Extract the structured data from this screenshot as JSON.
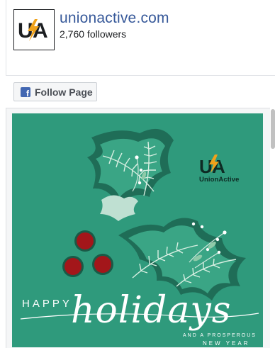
{
  "page": {
    "name": "unionactive.com",
    "followers": "2,760 followers",
    "avatar_text": "UA"
  },
  "follow_button": {
    "label": "Follow Page",
    "icon": "facebook-icon"
  },
  "post": {
    "brand_name": "UnionActive",
    "greeting_word": "HAPPY",
    "greeting_script": "holidays",
    "subline": "AND A PROSPEROUS",
    "subline2": "NEW YEAR"
  },
  "colors": {
    "link": "#365899",
    "card_green": "#2f9a7c",
    "facebook_blue": "#4267b2",
    "berry_red": "#a3161a",
    "bolt_orange": "#f0a21b"
  }
}
